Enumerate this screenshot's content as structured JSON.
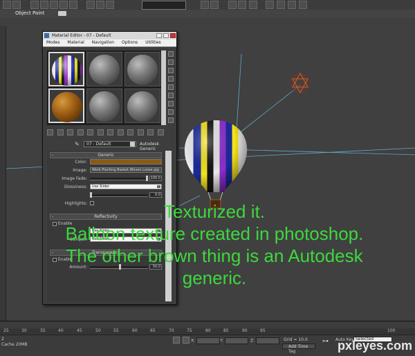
{
  "ribbon": {
    "label": "Object Paint"
  },
  "material_editor": {
    "title": "Material Editor - 07 - Default",
    "menu": [
      "Modes",
      "Material",
      "Navigation",
      "Options",
      "Utilities"
    ],
    "material_name": "07 - Default",
    "material_type": "Autodesk Generic",
    "generic": {
      "header": "Generic",
      "color_label": "Color:",
      "color_value": "#8b5b14",
      "image_label": "Image:",
      "image_value": "Work.Planting.Basket.Woven.Loose.jpg",
      "image_fade_label": "Image Fade:",
      "image_fade_value": "100.0",
      "glossiness_label": "Glossiness:",
      "glossiness_option": "Use Slider",
      "glossiness_value": "0.0",
      "highlights_label": "Highlights:"
    },
    "reflectivity": {
      "header": "Reflectivity",
      "enable_label": "Enable",
      "direct_option": "Use Slider",
      "oblique_label": "Oblique:",
      "oblique_option": "Use Slider"
    },
    "transparency": {
      "header": "Transparency",
      "enable_label": "Enable",
      "amount_label": "Amount:",
      "amount_value": "50.0"
    }
  },
  "caption": {
    "line1": "Texturized it.",
    "line2": "Balloon texture created in photoshop.",
    "line3": "The other brown thing is an Autodesk",
    "line4": "generic."
  },
  "timeline": {
    "ticks": [
      "25",
      "30",
      "35",
      "40",
      "45",
      "50",
      "55",
      "60",
      "65",
      "70",
      "75",
      "80",
      "85",
      "90",
      "95",
      "100"
    ]
  },
  "status": {
    "left_number": "2",
    "cache": "Cache 20MB",
    "x_label": "X:",
    "y_label": "Y:",
    "z_label": "Z:",
    "grid": "Grid = 10.0",
    "add_time_tag": "Add Time Tag",
    "auto_key": "Auto Key",
    "selection_option": "Selected"
  },
  "watermark": "pxleyes.com",
  "colors": {
    "caption_green": "#3dd83d",
    "viewport_bg": "#404040",
    "brown_material": "#8b5b14"
  }
}
